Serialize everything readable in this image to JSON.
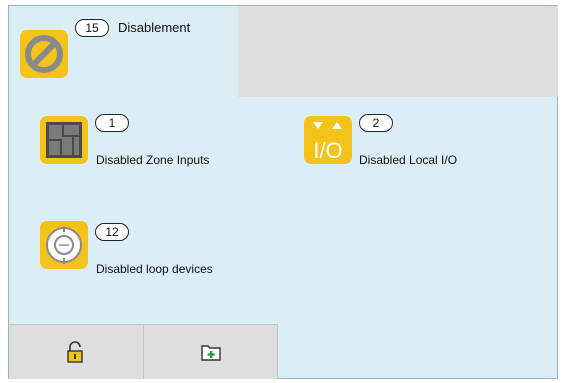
{
  "header": {
    "count": "15",
    "title": "Disablement",
    "icon": "disablement-icon"
  },
  "items": [
    {
      "count": "1",
      "label": "Disabled Zone Inputs",
      "icon": "zone-map-icon"
    },
    {
      "count": "2",
      "label": "Disabled Local I/O",
      "icon": "io-icon"
    },
    {
      "count": "12",
      "label": "Disabled loop devices",
      "icon": "loop-device-icon"
    }
  ],
  "io_icon_text": "I/O",
  "bottom_bar": [
    {
      "icon": "unlock-icon"
    },
    {
      "icon": "folder-add-icon"
    }
  ],
  "colors": {
    "panel": "#dbeef6",
    "tile": "#f3c319",
    "grey": "#dedede"
  }
}
